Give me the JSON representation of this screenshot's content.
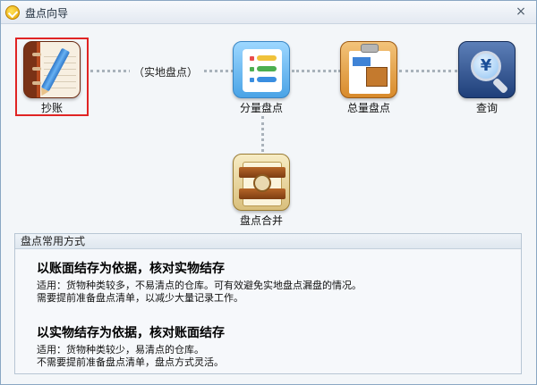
{
  "window": {
    "title": "盘点向导",
    "close_glyph": "×"
  },
  "flow": {
    "connector_label": "（实地盘点）",
    "nodes": [
      {
        "id": "copy-account",
        "label": "抄账",
        "icon": "notebook-pencil-icon",
        "selected": true
      },
      {
        "id": "partial-count",
        "label": "分量盘点",
        "icon": "checklist-icon"
      },
      {
        "id": "total-count",
        "label": "总量盘点",
        "icon": "clipboard-icon"
      },
      {
        "id": "query",
        "label": "查询",
        "icon": "yen-search-icon"
      },
      {
        "id": "merge",
        "label": "盘点合并",
        "icon": "merge-folder-icon"
      }
    ]
  },
  "panel": {
    "header": "盘点常用方式",
    "methods": [
      {
        "title": "以账面结存为依据，核对实物结存",
        "line1": "适用：货物种类较多，不易清点的仓库。可有效避免实地盘点漏盘的情况。",
        "line2": "需要提前准备盘点清单，以减少大量记录工作。"
      },
      {
        "title": "以实物结存为依据，核对账面结存",
        "line1": "适用：货物种类较少，易清点的仓库。",
        "line2": "不需要提前准备盘点清单，盘点方式灵活。"
      }
    ]
  },
  "colors": {
    "selection_border": "#e02424",
    "connector_dots": "#a9b2bb",
    "title_bar": "#e3e9f1"
  }
}
